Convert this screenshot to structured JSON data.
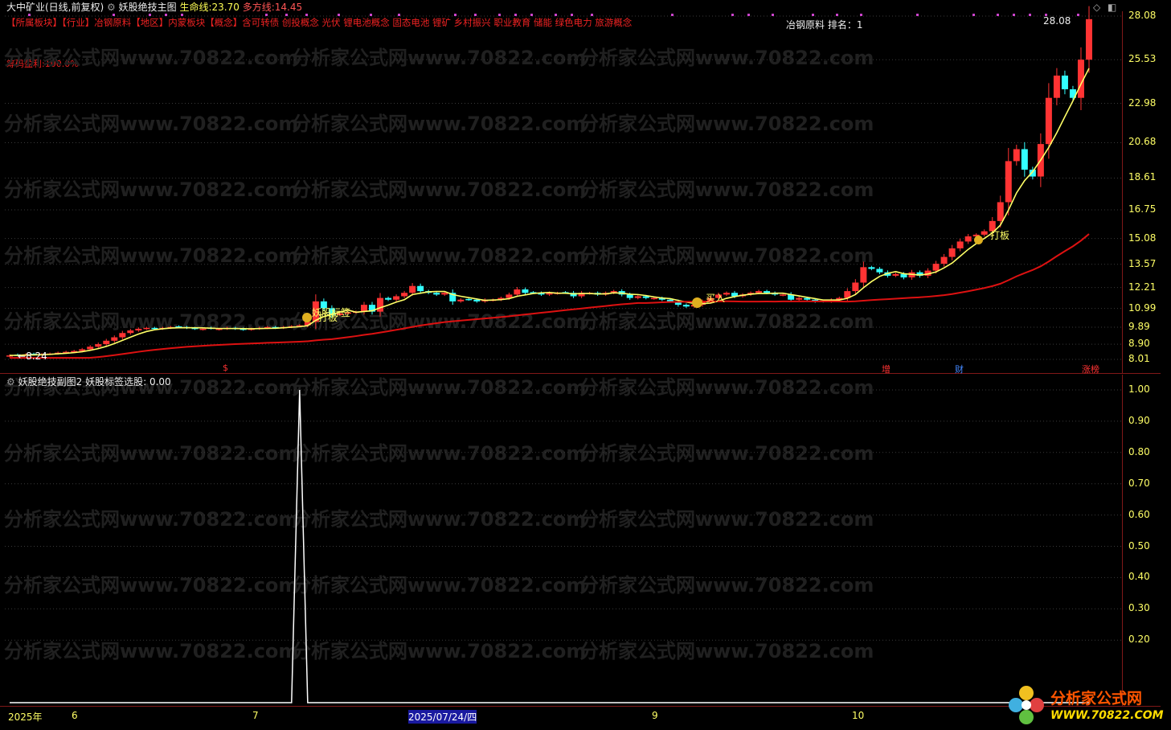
{
  "header": {
    "stock": "大中矿业(日线,前复权)",
    "indicator": "妖股绝技主图",
    "life_line_label": "生命线:",
    "life_line_value": "23.70",
    "bull_line_label": "多方线:",
    "bull_line_value": "14.45"
  },
  "concepts": "【所属板块】【行业】冶钢原料【地区】内蒙板块【概念】含可转债 创投概念 光伏 锂电池概念 固态电池 锂矿 乡村振兴 职业教育 储能 绿色电力 旅游概念",
  "chip_profit": "筹码盈利:100.0%",
  "rank_text": "冶钢原料 排名：1",
  "high_label": "28.08",
  "low_label": "8.24",
  "signals": {
    "tag": "妖股标签",
    "board": "打板",
    "buy": "买入",
    "board2": "打板"
  },
  "markers": {
    "dollar": "$",
    "add": "增",
    "fin": "财",
    "top": "涨榜"
  },
  "sub": {
    "title": "妖股绝技副图2",
    "value_label": "妖股标签选股:",
    "value": "0.00"
  },
  "watermark": "分析家公式网www.70822.com",
  "logo": {
    "name": "分析家公式网",
    "url": "WWW.70822.COM"
  },
  "x_labels": [
    "2025年",
    "6",
    "7",
    "2025/07/24/四",
    "9",
    "10"
  ],
  "colors": {
    "up": "#ff3333",
    "down": "#33ffff",
    "life": "#ffff66",
    "bull": "#dd1111"
  },
  "chart_data": [
    {
      "type": "candlestick",
      "title": "大中矿业(日线,前复权)",
      "yticks": [
        "28.08",
        "25.53",
        "22.98",
        "20.68",
        "18.61",
        "16.75",
        "15.08",
        "13.57",
        "12.21",
        "10.99",
        "9.89",
        "8.90",
        "8.01"
      ],
      "ylim": [
        8.01,
        28.08
      ],
      "closes": [
        8.24,
        8.25,
        8.3,
        8.3,
        8.32,
        8.35,
        8.4,
        8.45,
        8.5,
        8.6,
        8.75,
        8.9,
        9.1,
        9.3,
        9.55,
        9.7,
        9.8,
        9.85,
        9.8,
        9.85,
        9.9,
        9.9,
        9.85,
        9.8,
        9.8,
        9.82,
        9.8,
        9.85,
        9.8,
        9.75,
        9.8,
        9.85,
        9.9,
        9.85,
        9.9,
        9.95,
        10.0,
        10.2,
        11.4,
        11.0,
        10.6,
        10.7,
        10.75,
        10.8,
        11.2,
        10.8,
        11.6,
        11.5,
        11.7,
        11.9,
        12.3,
        12.0,
        11.9,
        11.8,
        11.9,
        11.4,
        11.5,
        11.5,
        11.4,
        11.5,
        11.5,
        11.6,
        11.8,
        12.1,
        11.9,
        11.9,
        11.8,
        11.9,
        11.9,
        11.9,
        11.7,
        11.9,
        11.9,
        11.8,
        11.9,
        12.0,
        11.8,
        11.6,
        11.7,
        11.6,
        11.6,
        11.5,
        11.4,
        11.2,
        11.1,
        11.2,
        11.4,
        11.6,
        11.8,
        11.9,
        11.7,
        11.8,
        11.9,
        12.0,
        11.9,
        11.8,
        11.8,
        11.5,
        11.6,
        11.5,
        11.4,
        11.4,
        11.5,
        11.6,
        12.0,
        12.5,
        13.4,
        13.3,
        13.1,
        12.9,
        13.0,
        12.8,
        13.1,
        12.9,
        13.2,
        13.6,
        14.0,
        14.5,
        14.9,
        15.2,
        15.3,
        15.5,
        16.1,
        17.2,
        19.6,
        20.3,
        19.1,
        18.7,
        20.6,
        23.3,
        24.6,
        23.8,
        23.3,
        25.53,
        27.9
      ],
      "life_line_last": 23.7,
      "bull_line_last": 14.45
    },
    {
      "type": "line",
      "title": "妖股标签选股",
      "yticks": [
        "1.00",
        "0.90",
        "0.80",
        "0.70",
        "0.60",
        "0.50",
        "0.40",
        "0.30",
        "0.20"
      ],
      "ylim": [
        0,
        1.0
      ],
      "spike_index": 36,
      "spike_value": 1.0
    }
  ]
}
